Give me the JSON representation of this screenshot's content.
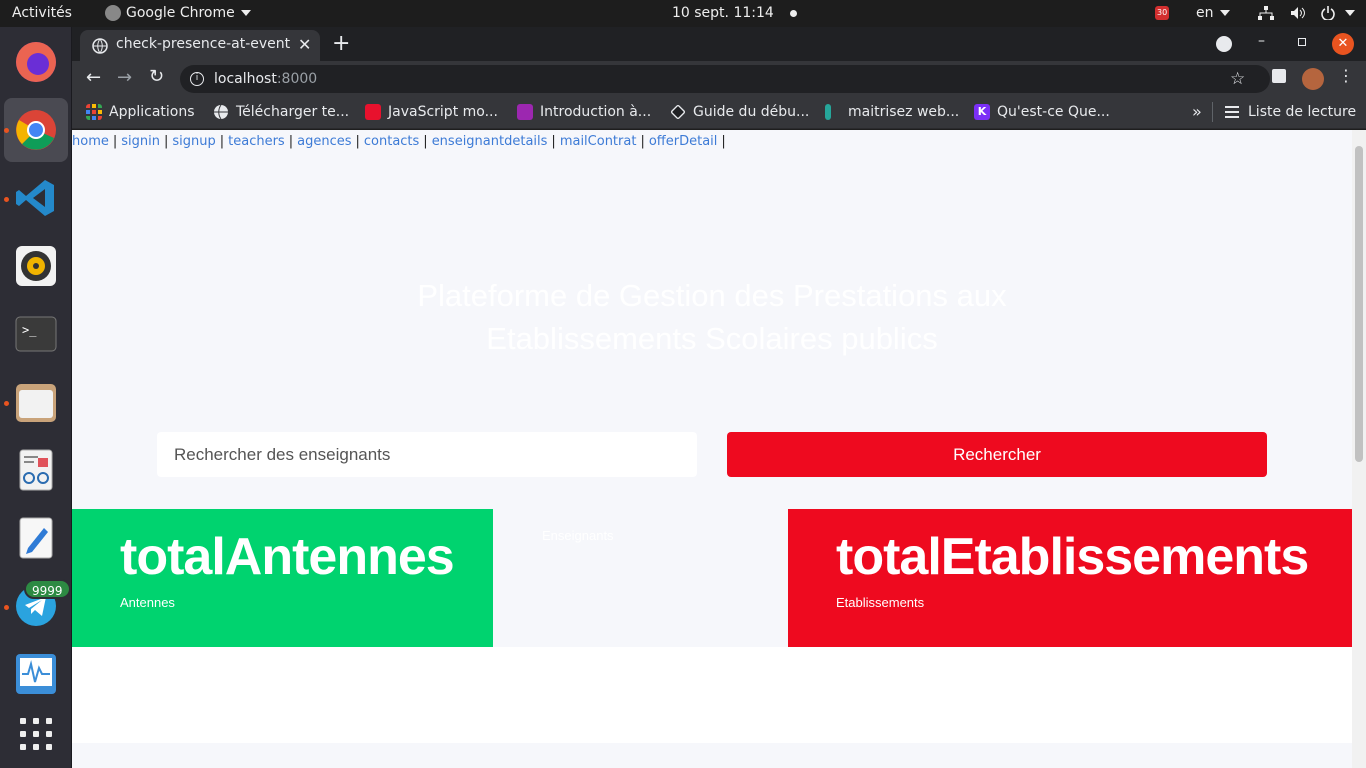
{
  "topbar": {
    "activities": "Activités",
    "app_name": "Google Chrome",
    "clock": "10 sept.  11:14",
    "lang": "en",
    "notif_count": "30"
  },
  "dock": {
    "telegram_badge": "9999"
  },
  "browser": {
    "tab_title": "check-presence-at-event",
    "url_host": "localhost",
    "url_port": ":8000",
    "bookmarks": [
      {
        "label": "Applications",
        "color": "#e8eaed"
      },
      {
        "label": "Télécharger te...",
        "color": "#e8eaed"
      },
      {
        "label": "JavaScript mo...",
        "color": "#e8112d"
      },
      {
        "label": "Introduction à...",
        "color": "#9c27b0"
      },
      {
        "label": "Guide du débu...",
        "color": "#e8eaed"
      },
      {
        "label": "maitrisez web...",
        "color": "#26a69a"
      },
      {
        "label": "Qu'est-ce Que...",
        "color": "#7b2ff7"
      }
    ],
    "more": "»",
    "reading_list": "Liste de lecture"
  },
  "page": {
    "nav": [
      "home",
      "signin",
      "signup",
      "teachers",
      "agences",
      "contacts",
      "enseignantdetails",
      "mailContrat",
      "offerDetail"
    ],
    "hero_line1": "Plateforme de Gestion des Prestations aux",
    "hero_line2": "Etablissements Scolaires publics",
    "search_placeholder": "Rechercher des enseignants",
    "search_button": "Rechercher",
    "stats": {
      "antennes_value": "totalAntennes",
      "antennes_label": "Antennes",
      "middle_label": "Enseignants",
      "etab_value": "totalEtablissements",
      "etab_label": "Etablissements"
    }
  },
  "colors": {
    "accent_red": "#ee0a1f",
    "accent_green": "#00d36f",
    "link": "#3d7bd6"
  }
}
